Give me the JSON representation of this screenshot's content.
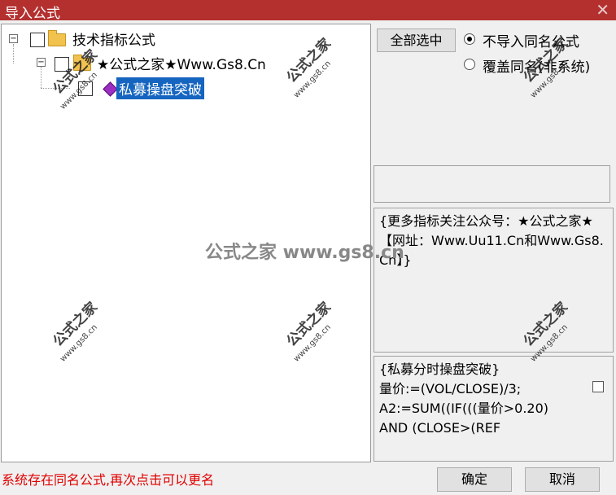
{
  "window": {
    "title": "导入公式",
    "close_glyph": "✕"
  },
  "tree": {
    "root_label": "技术指标公式",
    "child_label": "★公式之家★Www.Gs8.Cn",
    "leaf_label": "私募操盘突破"
  },
  "options": {
    "select_all_label": "全部选中",
    "radio_no_import": "不导入同名公式",
    "radio_overwrite": "覆盖同名(非系统)"
  },
  "info_text": "{更多指标关注公众号：★公式之家★ 【网址：Www.Uu11.Cn和Www.Gs8.Cn】}",
  "code_text": "{私募分时操盘突破}\n量价:=(VOL/CLOSE)/3;\nA2:=SUM((IF(((量价>0.20)\nAND (CLOSE>(REF",
  "status_message": "系统存在同名公式,再次点击可以更名",
  "buttons": {
    "ok": "确定",
    "cancel": "取消"
  },
  "watermark": {
    "title": "公式之家",
    "url": "www.gs8.cn",
    "center": "公式之家 www.gs8.cn"
  }
}
